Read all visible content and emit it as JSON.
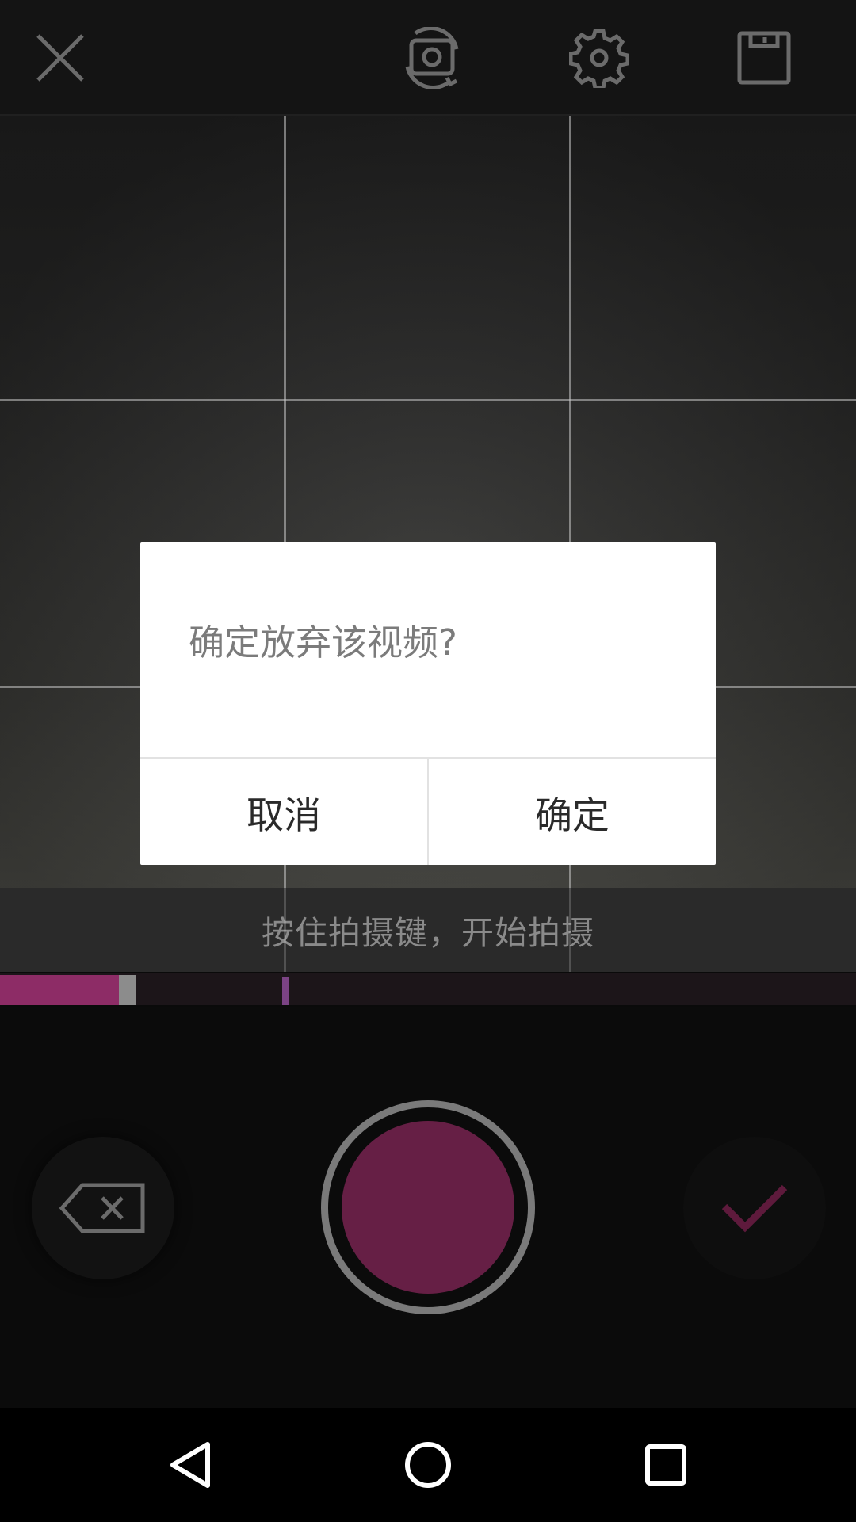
{
  "toolbar": {
    "close_icon": "close-icon",
    "flip_icon": "camera-flip-icon",
    "settings_icon": "gear-icon",
    "save_icon": "floppy-disk-icon"
  },
  "viewport": {
    "grid": "3x3"
  },
  "hint": {
    "text": "按住拍摄键，开始拍摄"
  },
  "progress": {
    "recorded_fraction": 0.139,
    "min_duration_marker_fraction": 0.33,
    "fill_color": "#8d2c66"
  },
  "controls": {
    "delete_icon": "backspace-icon",
    "record_color": "#661f45",
    "confirm_icon": "checkmark-icon",
    "confirm_color": "#5e1a3c"
  },
  "dialog": {
    "message": "确定放弃该视频?",
    "cancel_label": "取消",
    "ok_label": "确定"
  },
  "navbar": {
    "back_icon": "back-triangle-icon",
    "home_icon": "home-circle-icon",
    "recent_icon": "recent-square-icon"
  }
}
